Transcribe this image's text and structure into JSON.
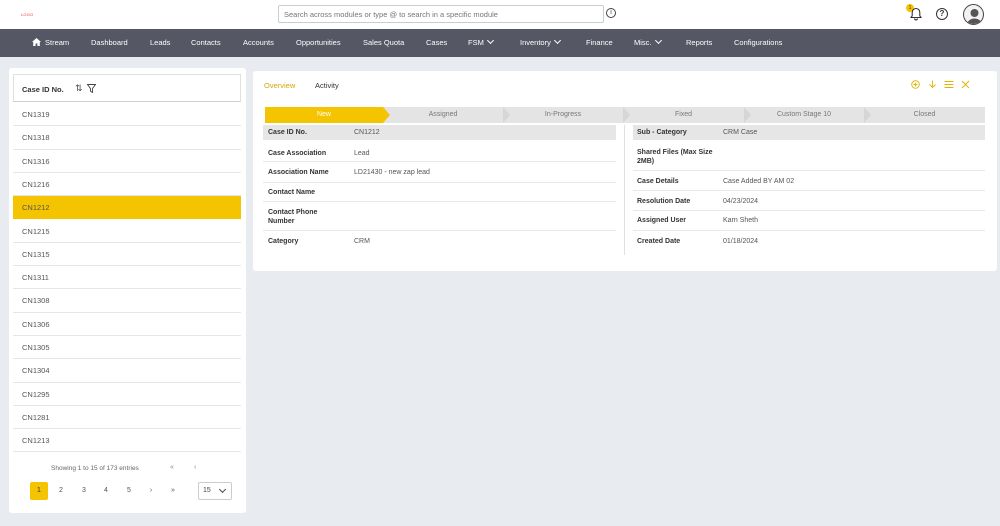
{
  "header": {
    "logo_text": "LOGO",
    "search_placeholder": "Search across modules or type @ to search in a specific module",
    "notification_count": "1"
  },
  "nav": {
    "items": [
      {
        "label": "Stream",
        "icon": "home-icon"
      },
      {
        "label": "Dashboard"
      },
      {
        "label": "Leads"
      },
      {
        "label": "Contacts"
      },
      {
        "label": "Accounts"
      },
      {
        "label": "Opportunities"
      },
      {
        "label": "Sales Quota"
      },
      {
        "label": "Cases",
        "active": true
      },
      {
        "label": "FSM",
        "dropdown": true
      },
      {
        "label": "Inventory",
        "dropdown": true
      },
      {
        "label": "Finance"
      },
      {
        "label": "Misc.",
        "dropdown": true
      },
      {
        "label": "Reports"
      },
      {
        "label": "Configurations"
      }
    ]
  },
  "case_list": {
    "header": "Case ID No.",
    "rows": [
      "CN1319",
      "CN1318",
      "CN1316",
      "CN1216",
      "CN1212",
      "CN1215",
      "CN1315",
      "CN1311",
      "CN1308",
      "CN1306",
      "CN1305",
      "CN1304",
      "CN1295",
      "CN1281",
      "CN1213"
    ],
    "selected": "CN1212",
    "pagination_info": "Showing 1 to 15 of 173 entries",
    "pages": [
      "1",
      "2",
      "3",
      "4",
      "5"
    ],
    "current_page": "1",
    "page_size": "15",
    "prev_label": "‹",
    "first_label": "«",
    "next_label": "›",
    "last_label": "»"
  },
  "detail": {
    "tabs": {
      "overview": "Overview",
      "activity": "Activity"
    },
    "stages": [
      "New",
      "Assigned",
      "In-Progress",
      "Fixed",
      "Custom Stage 10",
      "Closed"
    ],
    "current_stage": "New",
    "left_fields": [
      {
        "label": "Case ID No.",
        "value": "CN1212"
      },
      {
        "label": "Case Association",
        "value": "Lead"
      },
      {
        "label": "Association Name",
        "value": "LD21430 - new zap lead"
      },
      {
        "label": "Contact Name",
        "value": ""
      },
      {
        "label": "Contact Phone Number",
        "value": ""
      },
      {
        "label": "Category",
        "value": "CRM"
      }
    ],
    "right_fields": [
      {
        "label": "Sub - Category",
        "value": "CRM Case"
      },
      {
        "label": "Shared Files (Max Size 2MB)",
        "value": ""
      },
      {
        "label": "Case Details",
        "value": "Case Added BY AM 02"
      },
      {
        "label": "Resolution Date",
        "value": "04/23/2024"
      },
      {
        "label": "Assigned User",
        "value": "Karn Sheth"
      },
      {
        "label": "Created Date",
        "value": "01/18/2024"
      }
    ]
  },
  "colors": {
    "accent": "#f5c400",
    "nav_bg": "#555764",
    "page_bg": "#e8ebef"
  }
}
